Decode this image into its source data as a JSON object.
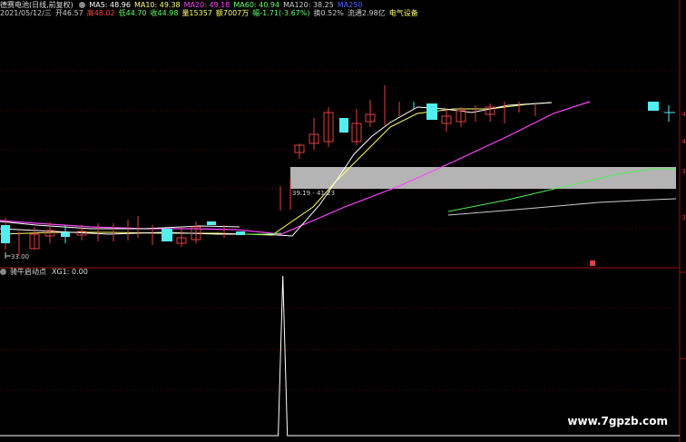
{
  "header": {
    "title": "德赛电池(日线,前复权)",
    "ma": [
      {
        "label": "MA5: 48.96",
        "color": "#ffffff"
      },
      {
        "label": "MA10: 49.38",
        "color": "#ffff66"
      },
      {
        "label": "MA20: 49.18",
        "color": "#ff44ff"
      },
      {
        "label": "MA60: 40.94",
        "color": "#66ff66"
      },
      {
        "label": "MA120: 38.25",
        "color": "#cccccc"
      },
      {
        "label": "MA250",
        "color": "#4466ff"
      }
    ],
    "info": [
      {
        "label": "2021/05/12/三",
        "color": "#cccccc"
      },
      {
        "label": "开46.57",
        "color": "#cccccc"
      },
      {
        "label": "高48.02",
        "color": "#ff4444"
      },
      {
        "label": "低44.70",
        "color": "#66ff66"
      },
      {
        "label": "收44.98",
        "color": "#66ff66"
      },
      {
        "label": "量15357",
        "color": "#ffff66"
      },
      {
        "label": "额7007万",
        "color": "#ffff66"
      },
      {
        "label": "幅-1.71(-3.67%)",
        "color": "#66ff66"
      },
      {
        "label": "换0.52%",
        "color": "#cccccc"
      },
      {
        "label": "流通2.98亿",
        "color": "#cccccc"
      },
      {
        "label": "电气设备",
        "color": "#ffff66"
      }
    ]
  },
  "main_chart": {
    "price_low_label": "33.00",
    "range_label": "39.19 - 41.23",
    "right_axis_ticks": [
      "4",
      "4",
      "3",
      "3"
    ]
  },
  "indicator": {
    "title": "骑牛启动点",
    "value_label": "XG1: 0.00",
    "xg1_values": [
      0,
      0,
      0,
      0,
      0,
      0,
      0,
      0,
      0,
      0,
      0,
      0,
      0,
      0,
      0,
      0,
      0,
      0,
      0,
      0,
      0,
      0,
      0,
      0,
      0,
      0,
      0,
      0,
      0,
      0,
      0,
      0,
      0,
      0,
      0,
      0,
      0,
      0,
      0,
      0,
      0,
      0,
      0,
      0,
      0,
      0,
      0,
      0,
      0,
      0,
      0,
      0,
      0,
      0,
      0,
      0,
      0,
      0,
      0,
      0,
      0,
      0,
      1,
      0,
      0,
      0,
      0,
      0,
      0,
      0,
      0,
      0,
      0,
      0,
      0,
      0,
      0,
      0,
      0,
      0,
      0,
      0,
      0,
      0,
      0,
      0,
      0,
      0,
      0,
      0,
      0,
      0,
      0,
      0,
      0,
      0,
      0,
      0,
      0,
      0,
      0,
      0,
      0,
      0,
      0,
      0,
      0,
      0,
      0,
      0,
      0,
      0,
      0,
      0,
      0,
      0,
      0,
      0,
      0,
      0,
      0,
      0,
      0,
      0,
      0,
      0,
      0,
      0,
      0,
      0,
      0,
      0,
      0,
      0,
      0,
      0,
      0,
      0,
      0,
      0,
      0,
      0,
      0,
      0,
      0,
      0,
      0,
      0,
      0,
      0
    ]
  },
  "watermark": "www.7gpzb.com"
}
